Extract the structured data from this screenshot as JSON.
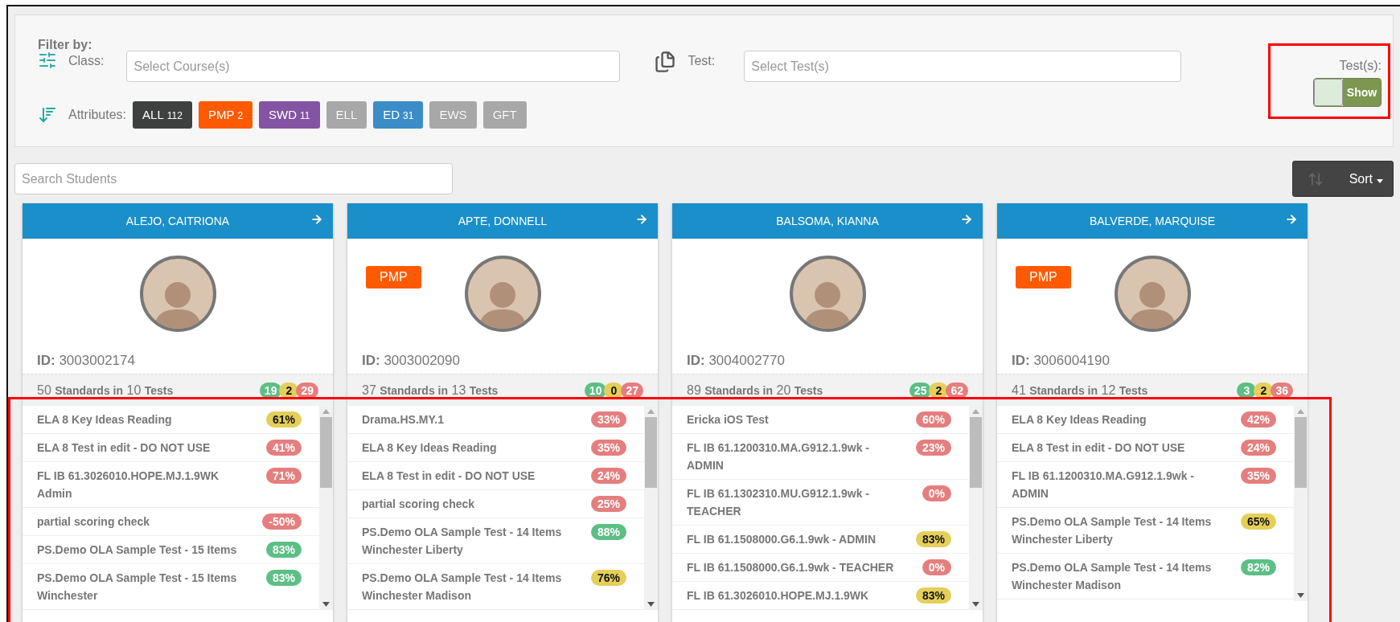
{
  "filter": {
    "heading": "Filter by:",
    "class_label": "Class:",
    "class_placeholder": "Select Course(s)",
    "test_label": "Test:",
    "test_placeholder": "Select Test(s)",
    "attributes_label": "Attributes:",
    "attributes": [
      {
        "label": "ALL",
        "count": "112",
        "color": "#3f4040",
        "disabled": false
      },
      {
        "label": "PMP",
        "count": "2",
        "color": "#ff5a00",
        "disabled": false
      },
      {
        "label": "SWD",
        "count": "11",
        "color": "#8354a4",
        "disabled": false
      },
      {
        "label": "ELL",
        "disabled": true
      },
      {
        "label": "ED",
        "count": "31",
        "color": "#3b8dc8",
        "disabled": false
      },
      {
        "label": "EWS",
        "disabled": true
      },
      {
        "label": "GFT",
        "disabled": true
      }
    ],
    "tests_toggle": {
      "label": "Test(s):",
      "text": "Show",
      "on": true
    }
  },
  "search": {
    "placeholder": "Search Students"
  },
  "sort": {
    "label": "Sort"
  },
  "students": [
    {
      "name": "ALEJO, CAITRIONA",
      "id_label": "ID:",
      "id": "3003002174",
      "standards": "50",
      "standards_label": "Standards in",
      "tests": "10",
      "tests_label": "Tests",
      "counts": [
        {
          "value": "19",
          "color": "#5cbf85"
        },
        {
          "value": "2",
          "color": "#e5cf5a"
        },
        {
          "value": "29",
          "color": "#e57e7e"
        }
      ],
      "results": [
        {
          "test": "ELA 8 Key Ideas Reading",
          "score": "61%",
          "color": "#e5cf5a"
        },
        {
          "test": "ELA 8 Test in edit - DO NOT USE",
          "score": "41%",
          "color": "#e57e7e"
        },
        {
          "test": "FL IB 61.3026010.HOPE.MJ.1.9WK Admin",
          "score": "71%",
          "color": "#e57e7e"
        },
        {
          "test": "partial scoring check",
          "score": "-50%",
          "color": "#e57e7e"
        },
        {
          "test": "PS.Demo OLA Sample Test - 15 Items",
          "score": "83%",
          "color": "#5cbf85"
        },
        {
          "test": "PS.Demo OLA Sample Test - 15 Items Winchester",
          "score": "83%",
          "color": "#5cbf85"
        }
      ]
    },
    {
      "name": "APTE, DONNELL",
      "badge": "PMP",
      "id_label": "ID:",
      "id": "3003002090",
      "standards": "37",
      "standards_label": "Standards in",
      "tests": "13",
      "tests_label": "Tests",
      "counts": [
        {
          "value": "10",
          "color": "#5cbf85"
        },
        {
          "value": "0",
          "color": "#e5cf5a"
        },
        {
          "value": "27",
          "color": "#e57e7e"
        }
      ],
      "results": [
        {
          "test": "Drama.HS.MY.1",
          "score": "33%",
          "color": "#e57e7e"
        },
        {
          "test": "ELA 8 Key Ideas Reading",
          "score": "35%",
          "color": "#e57e7e"
        },
        {
          "test": "ELA 8 Test in edit - DO NOT USE",
          "score": "24%",
          "color": "#e57e7e"
        },
        {
          "test": "partial scoring check",
          "score": "25%",
          "color": "#e57e7e"
        },
        {
          "test": "PS.Demo OLA Sample Test - 14 Items Winchester Liberty",
          "score": "88%",
          "color": "#5cbf85"
        },
        {
          "test": "PS.Demo OLA Sample Test - 14 Items Winchester Madison",
          "score": "76%",
          "color": "#e5cf5a"
        }
      ]
    },
    {
      "name": "BALSOMA, KIANNA",
      "id_label": "ID:",
      "id": "3004002770",
      "standards": "89",
      "standards_label": "Standards in",
      "tests": "20",
      "tests_label": "Tests",
      "counts": [
        {
          "value": "25",
          "color": "#5cbf85"
        },
        {
          "value": "2",
          "color": "#e5cf5a"
        },
        {
          "value": "62",
          "color": "#e57e7e"
        }
      ],
      "results": [
        {
          "test": "Ericka iOS Test",
          "score": "60%",
          "color": "#e57e7e"
        },
        {
          "test": "FL IB 61.1200310.MA.G912.1.9wk - ADMIN",
          "score": "23%",
          "color": "#e57e7e"
        },
        {
          "test": "FL IB 61.1302310.MU.G912.1.9wk - TEACHER",
          "score": "0%",
          "color": "#e57e7e"
        },
        {
          "test": "FL IB 61.1508000.G6.1.9wk - ADMIN",
          "score": "83%",
          "color": "#e5cf5a"
        },
        {
          "test": "FL IB 61.1508000.G6.1.9wk - TEACHER",
          "score": "0%",
          "color": "#e57e7e"
        },
        {
          "test": "FL IB 61.3026010.HOPE.MJ.1.9WK",
          "score": "83%",
          "color": "#e5cf5a"
        }
      ]
    },
    {
      "name": "BALVERDE, MARQUISE",
      "badge": "PMP",
      "id_label": "ID:",
      "id": "3006004190",
      "standards": "41",
      "standards_label": "Standards in",
      "tests": "12",
      "tests_label": "Tests",
      "counts": [
        {
          "value": "3",
          "color": "#5cbf85"
        },
        {
          "value": "2",
          "color": "#e5cf5a"
        },
        {
          "value": "36",
          "color": "#e57e7e"
        }
      ],
      "results": [
        {
          "test": "ELA 8 Key Ideas Reading",
          "score": "42%",
          "color": "#e57e7e"
        },
        {
          "test": "ELA 8 Test in edit - DO NOT USE",
          "score": "24%",
          "color": "#e57e7e"
        },
        {
          "test": "FL IB 61.1200310.MA.G912.1.9wk - ADMIN",
          "score": "35%",
          "color": "#e57e7e"
        },
        {
          "test": "PS.Demo OLA Sample Test - 14 Items Winchester Liberty",
          "score": "65%",
          "color": "#e5cf5a"
        },
        {
          "test": "PS.Demo OLA Sample Test - 14 Items Winchester Madison",
          "score": "82%",
          "color": "#5cbf85"
        }
      ]
    }
  ]
}
